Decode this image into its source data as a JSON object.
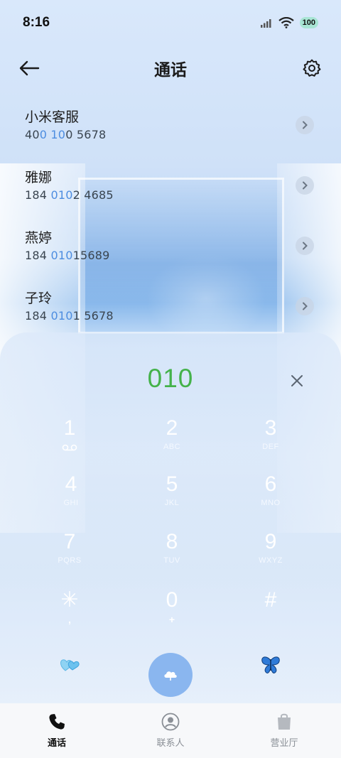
{
  "status_bar": {
    "time": "8:16",
    "battery": "100"
  },
  "header": {
    "title": "通话"
  },
  "contacts": [
    {
      "name": "小米客服",
      "number_parts": [
        "40",
        "0 10",
        "0 5678"
      ]
    },
    {
      "name": "雅娜",
      "number_parts": [
        "184 ",
        "010",
        "2 4685"
      ]
    },
    {
      "name": "燕婷",
      "number_parts": [
        "184 ",
        "010",
        "15689"
      ]
    },
    {
      "name": "子玲",
      "number_parts": [
        "184 ",
        "010",
        "1 5678"
      ]
    }
  ],
  "dialer": {
    "input": "010",
    "keys": [
      {
        "digit": "1",
        "sub": "voicemail"
      },
      {
        "digit": "2",
        "sub": "ABC"
      },
      {
        "digit": "3",
        "sub": "DEF"
      },
      {
        "digit": "4",
        "sub": "GHI"
      },
      {
        "digit": "5",
        "sub": "JKL"
      },
      {
        "digit": "6",
        "sub": "MNO"
      },
      {
        "digit": "7",
        "sub": "PQRS"
      },
      {
        "digit": "8",
        "sub": "TUV"
      },
      {
        "digit": "9",
        "sub": "WXYZ"
      },
      {
        "digit": "✳",
        "sub": ","
      },
      {
        "digit": "0",
        "sub": "+"
      },
      {
        "digit": "#",
        "sub": ""
      }
    ]
  },
  "bottom_nav": [
    {
      "label": "通话",
      "icon": "phone-icon",
      "active": true
    },
    {
      "label": "联系人",
      "icon": "contact-icon",
      "active": false
    },
    {
      "label": "营业厅",
      "icon": "bag-icon",
      "active": false
    }
  ],
  "colors": {
    "accent": "#44b24a",
    "highlight": "#4d8de0",
    "call_button": "#8ab6ef"
  }
}
